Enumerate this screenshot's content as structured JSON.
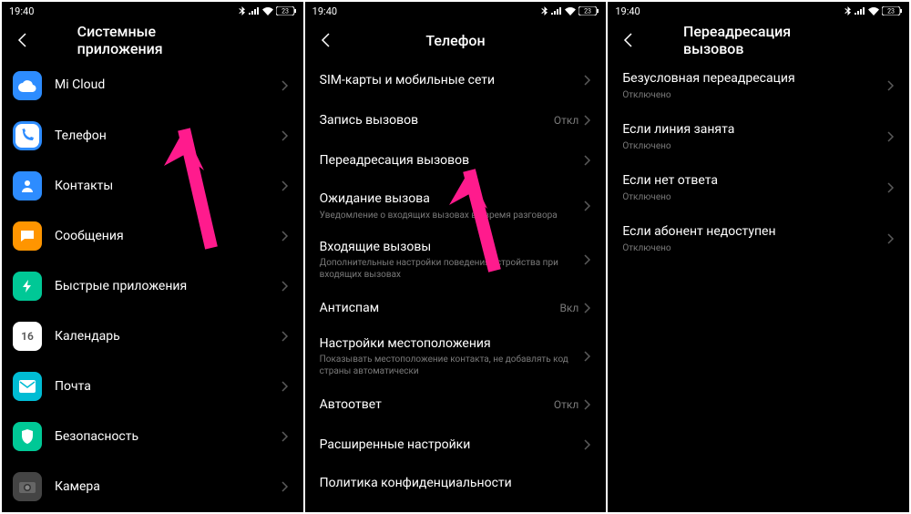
{
  "time": "19:40",
  "battery": "23",
  "screen1": {
    "title": "Системные приложения",
    "items": [
      {
        "label": "Mi Cloud",
        "icon": "cloud"
      },
      {
        "label": "Телефон",
        "icon": "phone"
      },
      {
        "label": "Контакты",
        "icon": "contacts"
      },
      {
        "label": "Сообщения",
        "icon": "msg"
      },
      {
        "label": "Быстрые приложения",
        "icon": "quick"
      },
      {
        "label": "Календарь",
        "icon": "cal",
        "cal_num": "16"
      },
      {
        "label": "Почта",
        "icon": "mail"
      },
      {
        "label": "Безопасность",
        "icon": "sec"
      },
      {
        "label": "Камера",
        "icon": "cam"
      }
    ]
  },
  "screen2": {
    "title": "Телефон",
    "items": [
      {
        "label": "SIM-карты и мобильные сети"
      },
      {
        "label": "Запись вызовов",
        "value": "Откл"
      },
      {
        "label": "Переадресация вызовов"
      },
      {
        "label": "Ожидание вызова",
        "sub": "Уведомление о входящих вызовах во время разговора"
      },
      {
        "label": "Входящие вызовы",
        "sub": "Дополнительные настройки поведения устройства при входящих вызовах"
      },
      {
        "label": "Антиспам",
        "value": "Вкл"
      },
      {
        "label": "Настройки местоположения",
        "sub": "Показывать местоположение контакта, не добавлять код страны автоматически"
      },
      {
        "label": "Автоответ",
        "value": "Откл"
      },
      {
        "label": "Расширенные настройки"
      },
      {
        "label": "Политика конфиденциальности"
      }
    ]
  },
  "screen3": {
    "title": "Переадресация вызовов",
    "items": [
      {
        "label": "Безусловная переадресация",
        "sub": "Отключено"
      },
      {
        "label": "Если линия занята",
        "sub": "Отключено"
      },
      {
        "label": "Если нет ответа",
        "sub": "Отключено"
      },
      {
        "label": "Если абонент недоступен",
        "sub": "Отключено"
      }
    ]
  }
}
